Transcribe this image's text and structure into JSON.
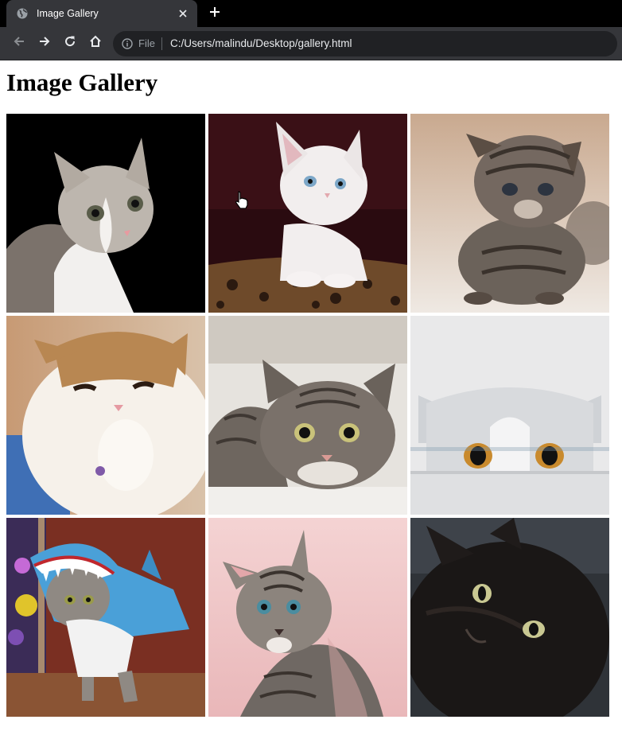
{
  "browser": {
    "tab_title": "Image Gallery",
    "address_scheme": "File",
    "address_url": "C:/Users/malindu/Desktop/gallery.html",
    "icons": {
      "favicon": "globe-icon",
      "close": "close-icon",
      "new_tab": "plus-icon",
      "back": "back-arrow-icon",
      "forward": "forward-arrow-icon",
      "reload": "reload-icon",
      "home": "home-icon",
      "info": "info-icon"
    }
  },
  "page": {
    "heading": "Image Gallery"
  },
  "gallery": {
    "images": [
      {
        "subject": "tabby-white cat on black background",
        "bg": "#000000",
        "fur": "#bdb6ae"
      },
      {
        "subject": "white kitten on leopard cushion",
        "bg": "#2a0b10",
        "fur": "#f2eeee"
      },
      {
        "subject": "tabby kitten on beige floor",
        "bg": "#b39a87",
        "fur": "#6b625a"
      },
      {
        "subject": "white-orange cat with paw on chin",
        "bg": "#c7a07c",
        "fur": "#f6f1ea"
      },
      {
        "subject": "tabby cat lying down",
        "bg": "#e6e3de",
        "fur": "#7a716a"
      },
      {
        "subject": "grey cat peeking over edge",
        "bg": "#e9e9ea",
        "fur": "#d8dadd"
      },
      {
        "subject": "cat in blue shark costume",
        "bg": "#7a2f22",
        "fur": "#4aa0d8"
      },
      {
        "subject": "tabby kitten on pink background",
        "bg": "#efc7c8",
        "fur": "#8c847d"
      },
      {
        "subject": "black cat looking up",
        "bg": "#2f3338",
        "fur": "#1a1716"
      }
    ]
  }
}
